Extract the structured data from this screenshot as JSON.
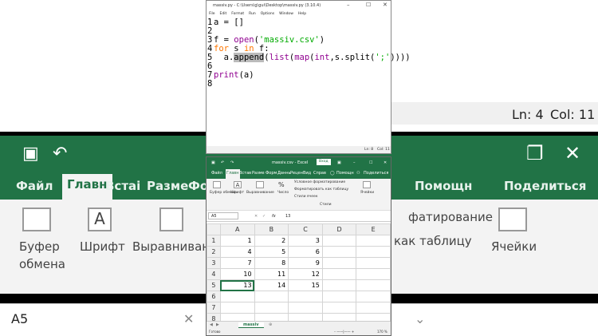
{
  "background": {
    "editor_status": {
      "line": "Ln: 4",
      "col": "Col: 11"
    },
    "tabs": [
      "Файл",
      "Главн",
      "Встаі",
      "Разме",
      "Фо",
      "Помощн",
      "Поделиться"
    ],
    "ribbon": {
      "clipboard": "Буфер",
      "clipboard2": "обмена",
      "font": "Шрифт",
      "alignment": "Выравнивани",
      "cond_format": "фатирование",
      "table_format": "как таблицу",
      "cells": "Ячейки"
    },
    "name_box": "A5"
  },
  "editor": {
    "title": "massiv.py - C:\\Users\\g\\gui\\Desktop\\massiv.py (3.10.4)",
    "menu": [
      "File",
      "Edit",
      "Format",
      "Run",
      "Options",
      "Window",
      "Help"
    ],
    "code": [
      {
        "n": "1",
        "t": "a = []"
      },
      {
        "n": "2",
        "t": ""
      },
      {
        "n": "3",
        "t": "f = open('massiv.csv')"
      },
      {
        "n": "4",
        "t": "for s in f:"
      },
      {
        "n": "5",
        "t": "  a.append(list(map(int,s.split(';'))))"
      },
      {
        "n": "6",
        "t": ""
      },
      {
        "n": "7",
        "t": "print(a)"
      },
      {
        "n": "8",
        "t": ""
      }
    ],
    "status": {
      "line": "Ln: 8",
      "col": "Col: 11"
    }
  },
  "excel": {
    "title": "massiv.csv - Excel",
    "signin": "Вход",
    "tabs": [
      "Файл",
      "Главн",
      "Встав",
      "Разме",
      "Форм",
      "Данны",
      "Рецен",
      "Вид",
      "Справ",
      "Помощн",
      "Поделиться"
    ],
    "ribbon": {
      "clipboard": "Буфер обмена",
      "font": "Шрифт",
      "alignment": "Выравнивание",
      "number": "Число",
      "cond_format": "Условное форматирование",
      "table_format": "Форматировать как таблицу",
      "cell_styles": "Стили ячеек",
      "styles": "Стили",
      "cells": "Ячейки"
    },
    "name_box": "A5",
    "fx": "fx",
    "formula": "13",
    "columns": [
      "A",
      "B",
      "C",
      "D",
      "E"
    ],
    "rows": [
      {
        "n": "1",
        "cells": [
          "1",
          "2",
          "3",
          "",
          ""
        ]
      },
      {
        "n": "2",
        "cells": [
          "4",
          "5",
          "6",
          "",
          ""
        ]
      },
      {
        "n": "3",
        "cells": [
          "7",
          "8",
          "9",
          "",
          ""
        ]
      },
      {
        "n": "4",
        "cells": [
          "10",
          "11",
          "12",
          "",
          ""
        ]
      },
      {
        "n": "5",
        "cells": [
          "13",
          "14",
          "15",
          "",
          ""
        ]
      },
      {
        "n": "6",
        "cells": [
          "",
          "",
          "",
          "",
          ""
        ]
      },
      {
        "n": "7",
        "cells": [
          "",
          "",
          "",
          "",
          ""
        ]
      },
      {
        "n": "8",
        "cells": [
          "",
          "",
          "",
          "",
          ""
        ]
      }
    ],
    "sheet_tab": "massiv",
    "status_ready": "Готово",
    "zoom": "170 %"
  }
}
